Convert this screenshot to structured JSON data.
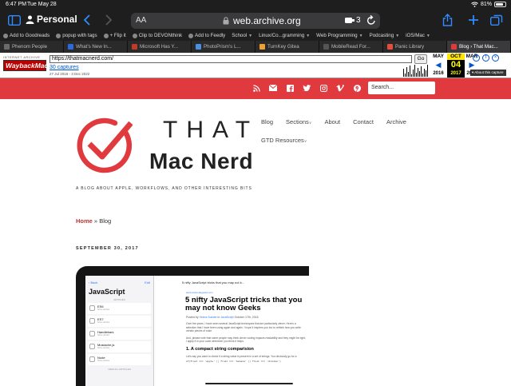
{
  "status": {
    "time": "6:47 PM",
    "date": "Tue May 28",
    "battery": "81%"
  },
  "toolbar": {
    "profile": "Personal",
    "aa": "AA",
    "host": "web.archive.org",
    "ext_count": "3"
  },
  "bookmarks": [
    {
      "label": "Add to Goodreads"
    },
    {
      "label": "popup with tags"
    },
    {
      "label": "+ Flip it"
    },
    {
      "label": "Clip to DEVONthink"
    },
    {
      "label": "Add to Feedly"
    },
    {
      "label": "School",
      "folder": true
    },
    {
      "label": "Linux/Co...gramming",
      "folder": true
    },
    {
      "label": "Web Programming",
      "folder": true
    },
    {
      "label": "Podcasting",
      "folder": true
    },
    {
      "label": "iOS/Mac",
      "folder": true
    }
  ],
  "tabs": [
    {
      "label": "Phenom People",
      "color": "#6a6a6a"
    },
    {
      "label": "What's New In...",
      "color": "#2a6ad9"
    },
    {
      "label": "Microsoft Has Y...",
      "color": "#c0392b"
    },
    {
      "label": "PhotoPrism's L...",
      "color": "#4a90e2"
    },
    {
      "label": "TurnKey Gitea",
      "color": "#f0a030"
    },
    {
      "label": "MobileRead For...",
      "color": "#555555"
    },
    {
      "label": "Panic Library",
      "color": "#e74c3c"
    },
    {
      "label": "Blog › That Mac...",
      "color": "#e0393e",
      "active": true
    }
  ],
  "wayback": {
    "logo_top": "INTERNET ARCHIVE",
    "logo_main": "WaybackMachine",
    "url": "https://thatmacnerd.com/",
    "go": "Go",
    "captures": "30 captures",
    "range": "27 Jul 2016 - 3 Dec 2022",
    "prev": {
      "month": "MAY",
      "year": "2016"
    },
    "current": {
      "month": "OCT",
      "day": "04",
      "year": "2017"
    },
    "next": {
      "month": "MAR",
      "year": "2018"
    },
    "about": "▾ About this capture"
  },
  "site": {
    "search_placeholder": "Search...",
    "logo_word1": "THAT",
    "logo_word2": "Mac Nerd",
    "tagline": "A BLOG ABOUT APPLE, WORKFLOWS, AND OTHER INTERESTING BITS",
    "nav": [
      "Blog",
      "Sections",
      "About",
      "Contact",
      "Archive"
    ],
    "nav2": "GTD Resources",
    "breadcrumb_home": "Home",
    "breadcrumb_sep": " » ",
    "breadcrumb_current": "Blog",
    "post_date": "SEPTEMBER 30, 2017",
    "colors": {
      "accent": "#e0393e",
      "link": "#c0332f"
    }
  },
  "screenshot": {
    "back": "‹ Back",
    "edit": "Edit",
    "list_title": "JavaScript",
    "list_caption": "ARTICLES",
    "items": [
      {
        "name": "ES6",
        "sub": "Some articles"
      },
      {
        "name": "ES7",
        "sub": "Some articles"
      },
      {
        "name": "Handlebars",
        "sub": "Some articles"
      },
      {
        "name": "Mustache.js",
        "sub": "Some articles"
      },
      {
        "name": "Node",
        "sub": "Some articles"
      }
    ],
    "more": "VIEW ALL ARTICLES",
    "page_title": "5 nifty JavaScript tricks that you may not k...",
    "page_link": "www.webcodegeeks.com",
    "headline": "5 nifty JavaScript tricks that you may not know Geeks",
    "meta_prefix": "Posted by",
    "meta_author": "Yeena Sunder",
    "meta_mid": "in",
    "meta_cat": "JavaScript",
    "meta_date": "October 17th, 2016",
    "para1": "Over the years, I have seen several JavaScript techniques that are particularly clever. Here's a selection that I have been using again and again. I hope it inspires you too to rethink how you write certain pieces of code.",
    "para2": "And, please note that some people may think clever coding impacts readability and they might be right. I apply it in your code whenever you think it helps.",
    "h2": "1. A compact string comparision",
    "para3": "Let's say you want to check if a string value is present in a set of strings. You obviously go for a",
    "code": "if(fruit === 'apple' || fruit === 'banana' || fruit === 'chicken')"
  }
}
